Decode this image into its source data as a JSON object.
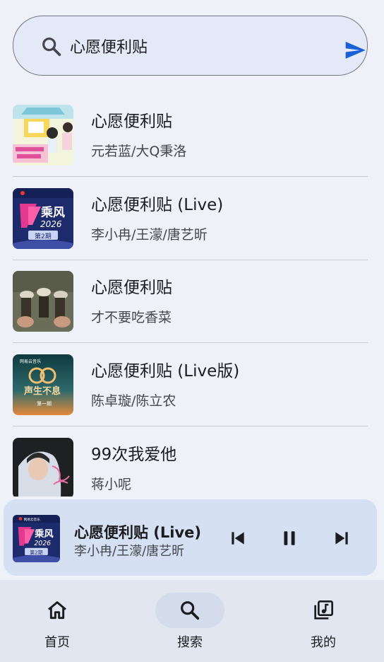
{
  "search": {
    "value": "心愿便利贴"
  },
  "results": [
    {
      "title": "心愿便利贴",
      "artist": "元若蓝/大Q秉洛",
      "cover": "cartoon-couple-cover"
    },
    {
      "title": "心愿便利贴 (Live)",
      "artist": "李小冉/王濛/唐艺昕",
      "cover": "chengfeng-2026-cover",
      "cover_text": [
        "乘风",
        "2026",
        "第2期"
      ]
    },
    {
      "title": "心愿便利贴",
      "artist": "才不要吃香菜",
      "cover": "sneakers-photo-cover"
    },
    {
      "title": "心愿便利贴 (Live版)",
      "artist": "陈卓璇/陈立农",
      "cover": "shengshengbuxi-cover",
      "cover_text": [
        "网易云音乐",
        "声生不息",
        "第一期"
      ]
    },
    {
      "title": "99次我爱他",
      "artist": "蒋小呢",
      "cover": "hoodie-portrait-cover"
    }
  ],
  "player": {
    "title": "心愿便利贴 (Live)",
    "artist": "李小冉/王濛/唐艺昕",
    "cover": "chengfeng-2026-cover",
    "cover_text": [
      "网易云音乐",
      "乘风",
      "2026",
      "第2期"
    ]
  },
  "nav": [
    {
      "label": "首页",
      "icon": "home-icon",
      "active": false
    },
    {
      "label": "搜索",
      "icon": "search-icon",
      "active": true
    },
    {
      "label": "我的",
      "icon": "library-music-icon",
      "active": false
    }
  ],
  "colors": {
    "accent": "#1a5fd6",
    "background": "#eef1f8",
    "player_bg": "#d5e0f2",
    "nav_bg": "#e1e6f1"
  }
}
